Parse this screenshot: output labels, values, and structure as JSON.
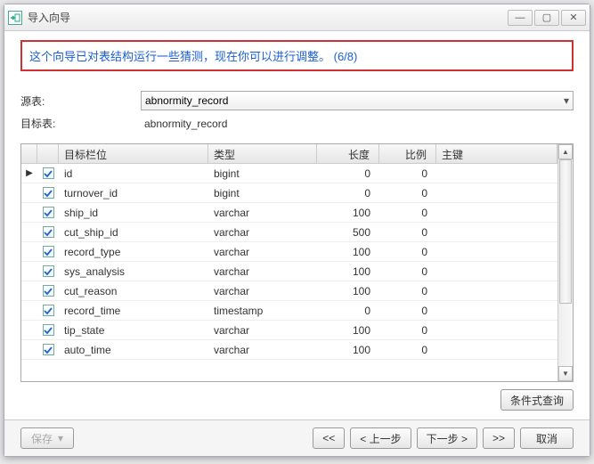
{
  "window": {
    "title": "导入向导"
  },
  "winControls": {
    "min": "—",
    "max": "▢",
    "close": "✕"
  },
  "info": {
    "message": "这个向导已对表结构运行一些猜测，现在你可以进行调整。 (6/8)"
  },
  "labels": {
    "source": "源表:",
    "target": "目标表:",
    "col_field": "目标栏位",
    "col_type": "类型",
    "col_len": "长度",
    "col_ratio": "比例",
    "col_key": "主键"
  },
  "source": {
    "value": "abnormity_record"
  },
  "target": {
    "value": "abnormity_record"
  },
  "columns": [
    {
      "checked": true,
      "name": "id",
      "type": "bigint",
      "len": "0",
      "ratio": "0",
      "current": true
    },
    {
      "checked": true,
      "name": "turnover_id",
      "type": "bigint",
      "len": "0",
      "ratio": "0"
    },
    {
      "checked": true,
      "name": "ship_id",
      "type": "varchar",
      "len": "100",
      "ratio": "0"
    },
    {
      "checked": true,
      "name": "cut_ship_id",
      "type": "varchar",
      "len": "500",
      "ratio": "0"
    },
    {
      "checked": true,
      "name": "record_type",
      "type": "varchar",
      "len": "100",
      "ratio": "0"
    },
    {
      "checked": true,
      "name": "sys_analysis",
      "type": "varchar",
      "len": "100",
      "ratio": "0"
    },
    {
      "checked": true,
      "name": "cut_reason",
      "type": "varchar",
      "len": "100",
      "ratio": "0"
    },
    {
      "checked": true,
      "name": "record_time",
      "type": "timestamp",
      "len": "0",
      "ratio": "0"
    },
    {
      "checked": true,
      "name": "tip_state",
      "type": "varchar",
      "len": "100",
      "ratio": "0"
    },
    {
      "checked": true,
      "name": "auto_time",
      "type": "varchar",
      "len": "100",
      "ratio": "0"
    }
  ],
  "buttons": {
    "condition_query": "条件式查询",
    "save": "保存",
    "first": "<<",
    "prev": "< 上一步",
    "next": "下一步 >",
    "last": ">>",
    "cancel": "取消"
  }
}
